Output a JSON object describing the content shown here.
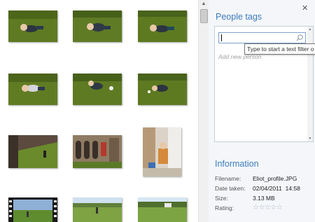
{
  "people_tags": {
    "title": "People tags",
    "search_value": "",
    "add_placeholder": "Add new person",
    "tooltip": "Type to start a text filter o"
  },
  "information": {
    "title": "Information",
    "rows": [
      {
        "label": "Filename:",
        "value": "Eliot_profile.JPG"
      },
      {
        "label": "Date taken:",
        "value": "02/04/2011  14:58"
      },
      {
        "label": "Size:",
        "value": "3.13 MB"
      },
      {
        "label": "Rating:",
        "value": ""
      }
    ],
    "rating_stars": 0,
    "rating_max": 5
  },
  "icons": {
    "close": "close-icon",
    "search": "search-icon",
    "star": "star-icon"
  },
  "colors": {
    "panel_heading": "#3c7bbd",
    "panel_bg": "#f4f6f9"
  }
}
